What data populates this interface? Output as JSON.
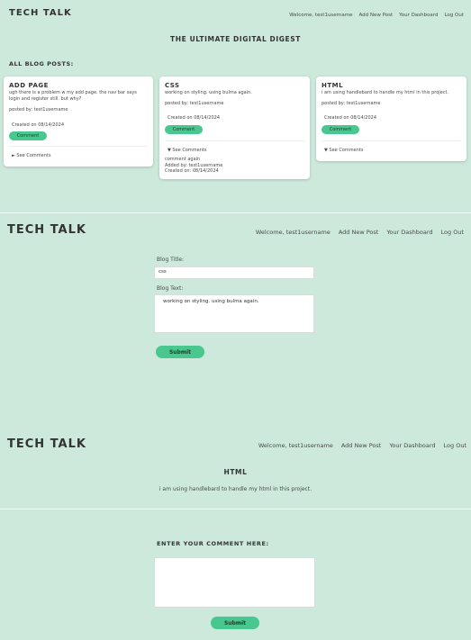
{
  "s1": {
    "brand": "Tech Talk",
    "nav": [
      "Welcome, test1username",
      "Add New Post",
      "Your Dashboard",
      "Log Out"
    ],
    "digest_title": "The Ultimate Digital Digest",
    "all_posts_label": "All Blog Posts:",
    "cards": [
      {
        "title": "add page",
        "body": "ugh there is a problem w my add page. the nav bar says login and register still. but why?",
        "posted": "posted by: test1username",
        "created": "Created on 08/14/2024",
        "comment_btn": "Comment",
        "see_comments": "► See Comments"
      },
      {
        "title": "css",
        "body": "working on styling. using bulma again.",
        "posted": "posted by: test1username",
        "created": "Created on 08/14/2024",
        "comment_btn": "Comment",
        "see_comments": "▼ See Comments",
        "comment_text": "comment again",
        "comment_added": "Added by: test1username",
        "comment_created": "Created on: 08/14/2024"
      },
      {
        "title": "html",
        "body": "i am using handlebard to handle my html in this project.",
        "posted": "posted by: test1username",
        "created": "Created on 08/14/2024",
        "comment_btn": "Comment",
        "see_comments": "▼ See Comments"
      }
    ]
  },
  "s2": {
    "brand": "Tech Talk",
    "nav": [
      "Welcome, test1username",
      "Add New Post",
      "Your Dashboard",
      "Log Out"
    ],
    "title_label": "Blog Title:",
    "title_value": "css",
    "text_label": "Blog Text:",
    "text_value": "working on styling.  using bulma again.",
    "submit": "Submit"
  },
  "s3": {
    "brand": "Tech Talk",
    "nav": [
      "Welcome, test1username",
      "Add New Post",
      "Your Dashboard",
      "Log Out"
    ],
    "post_title": "html",
    "post_text": "i am using handlebard to handle my html in this project."
  },
  "s4": {
    "comment_label": "Enter your comment here:",
    "comment_value": "",
    "submit": "Submit"
  },
  "colors": {
    "background": "#cde9dc",
    "accent": "#48c78e",
    "card": "#ffffff"
  }
}
